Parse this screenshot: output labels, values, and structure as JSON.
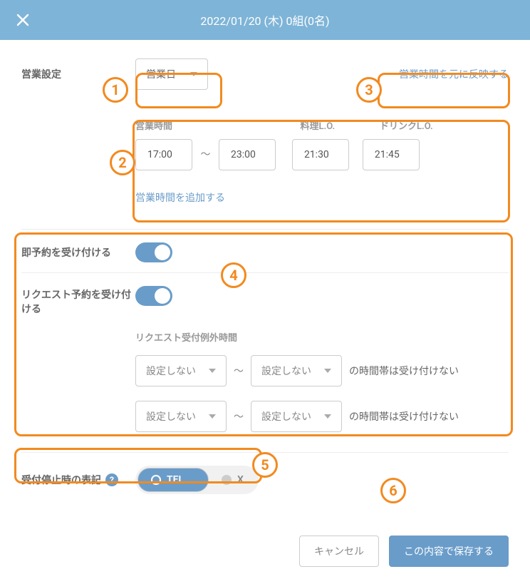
{
  "header": {
    "title": "2022/01/20 (木) 0組(0名)"
  },
  "biz": {
    "label": "営業設定",
    "select": "営業日",
    "reflect_link": "営業時間を元に反映する"
  },
  "hours": {
    "time_label": "営業時間",
    "food_lo_label": "料理L.O.",
    "drink_lo_label": "ドリンクL.O.",
    "open": "17:00",
    "close": "23:00",
    "food_lo": "21:30",
    "drink_lo": "21:45",
    "add_link": "営業時間を追加する"
  },
  "instant": {
    "label": "即予約を受け付ける"
  },
  "request": {
    "label": "リクエスト予約を受け付ける",
    "excl_title": "リクエスト受付例外時間",
    "noset": "設定しない",
    "suffix": "の時間帯は受け付けない"
  },
  "stopnote": {
    "label": "受付停止時の表記",
    "tel": "TEL",
    "x": "X"
  },
  "footer": {
    "cancel": "キャンセル",
    "save": "この内容で保存する"
  }
}
